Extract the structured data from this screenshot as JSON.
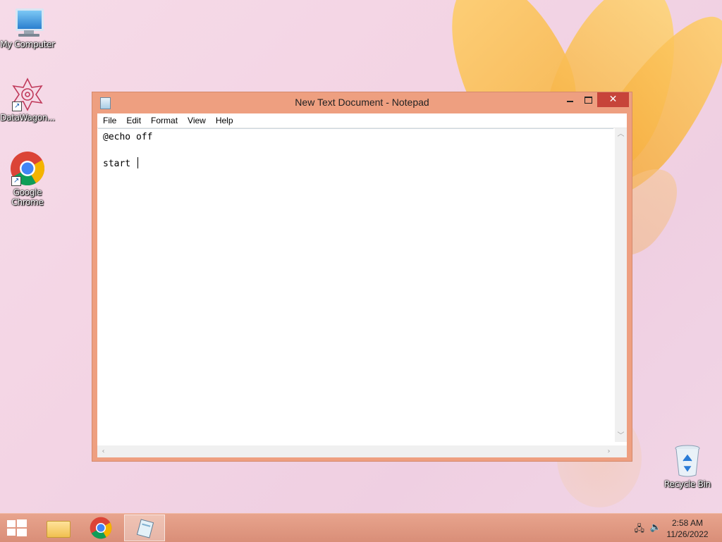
{
  "desktop": {
    "icons": [
      {
        "label": "My Computer"
      },
      {
        "label": "DataWagon..."
      },
      {
        "label": "Google Chrome"
      },
      {
        "label": "Recycle Bin"
      }
    ]
  },
  "window": {
    "title": "New Text Document - Notepad",
    "menu": [
      "File",
      "Edit",
      "Format",
      "View",
      "Help"
    ],
    "lines": [
      "@echo off",
      "",
      "start "
    ],
    "close_glyph": "✕"
  },
  "taskbar": {
    "apps": [
      "file-explorer",
      "google-chrome",
      "notepad"
    ],
    "active": "notepad",
    "time": "2:58 AM",
    "date": "11/26/2022"
  }
}
